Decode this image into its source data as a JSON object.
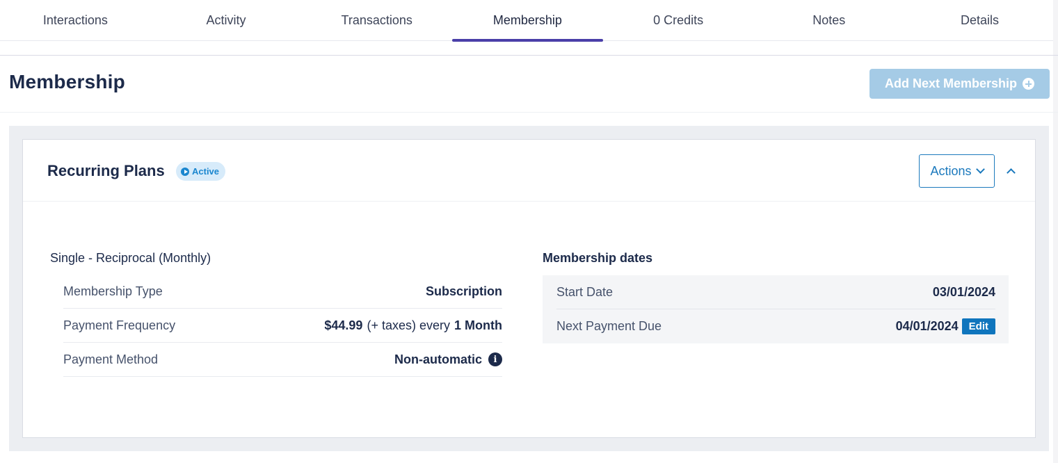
{
  "tabs": [
    {
      "label": "Interactions",
      "active": false
    },
    {
      "label": "Activity",
      "active": false
    },
    {
      "label": "Transactions",
      "active": false
    },
    {
      "label": "Membership",
      "active": true
    },
    {
      "label": "0 Credits",
      "active": false
    },
    {
      "label": "Notes",
      "active": false
    },
    {
      "label": "Details",
      "active": false
    }
  ],
  "page": {
    "title": "Membership",
    "add_button": "Add Next Membership"
  },
  "card": {
    "title": "Recurring Plans",
    "status_badge": "Active",
    "actions_label": "Actions",
    "plan_name": "Single - Reciprocal (Monthly)",
    "details": {
      "membership_type": {
        "label": "Membership Type",
        "value": "Subscription"
      },
      "payment_frequency": {
        "label": "Payment Frequency",
        "amount": "$44.99",
        "suffix": "(+ taxes) every",
        "period": "1 Month"
      },
      "payment_method": {
        "label": "Payment Method",
        "value": "Non-automatic"
      }
    },
    "dates": {
      "title": "Membership dates",
      "start": {
        "label": "Start Date",
        "value": "03/01/2024"
      },
      "next_payment": {
        "label": "Next Payment Due",
        "value": "04/01/2024",
        "edit_label": "Edit"
      }
    }
  },
  "colors": {
    "accent_tab": "#4a3fa8",
    "primary_blue": "#1b79bd",
    "disabled_button": "#a5cbe6",
    "badge_bg": "#d7ebfa"
  },
  "icons": [
    "plus-circle-icon",
    "play-circle-icon",
    "chevron-down-icon",
    "chevron-up-icon",
    "info-icon"
  ]
}
